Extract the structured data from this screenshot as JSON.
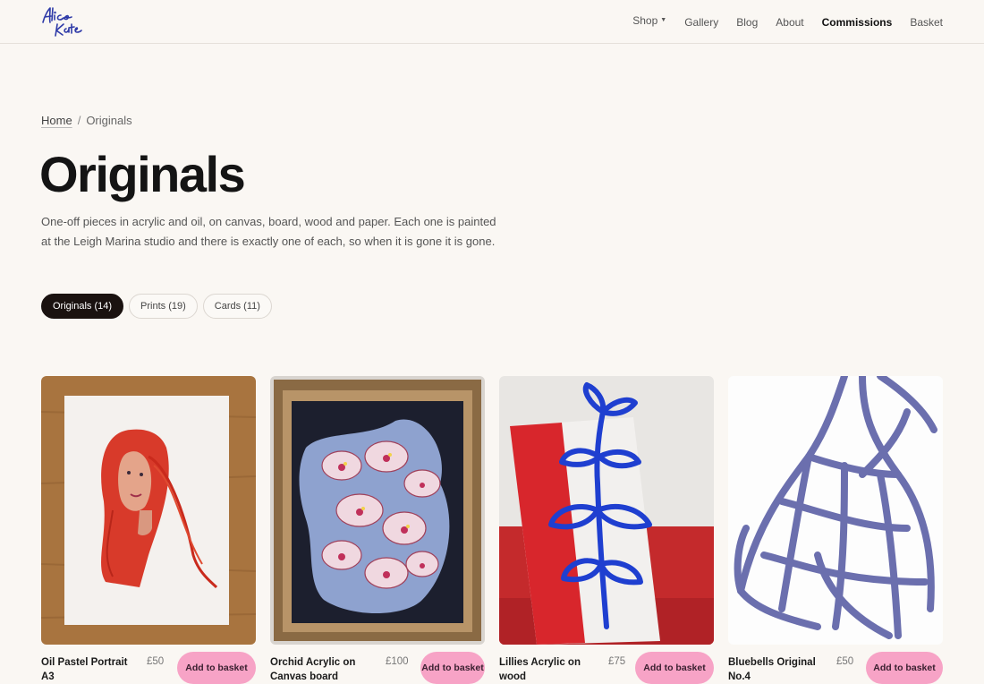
{
  "brand": {
    "logo_alt": "Alice Kate"
  },
  "nav": {
    "shop": "Shop",
    "gallery": "Gallery",
    "blog": "Blog",
    "about": "About",
    "commissions": "Commissions",
    "basket": "Basket"
  },
  "breadcrumb": {
    "home": "Home",
    "sep": "/",
    "current": "Originals"
  },
  "page": {
    "title": "Originals",
    "intro": "One-off pieces in acrylic and oil, on canvas, board, wood and paper. Each one is painted at the Leigh Marina studio and there is exactly one of each, so when it is gone it is gone."
  },
  "filters": [
    {
      "label": "Originals (14)",
      "active": true
    },
    {
      "label": "Prints (19)",
      "active": false
    },
    {
      "label": "Cards (11)",
      "active": false
    }
  ],
  "products": [
    {
      "name": "Oil Pastel Portrait A3",
      "price": "£50",
      "button": "Add to basket"
    },
    {
      "name": "Orchid Acrylic on Canvas board",
      "price": "£100",
      "button": "Add to basket"
    },
    {
      "name": "Lillies Acrylic on wood",
      "price": "£75",
      "button": "Add to basket"
    },
    {
      "name": "Bluebells Original No.4",
      "price": "£50",
      "button": "Add to basket"
    }
  ],
  "colors": {
    "accent_pink": "#f7a3c6",
    "active_pill": "#1a1210",
    "background": "#faf7f3"
  }
}
